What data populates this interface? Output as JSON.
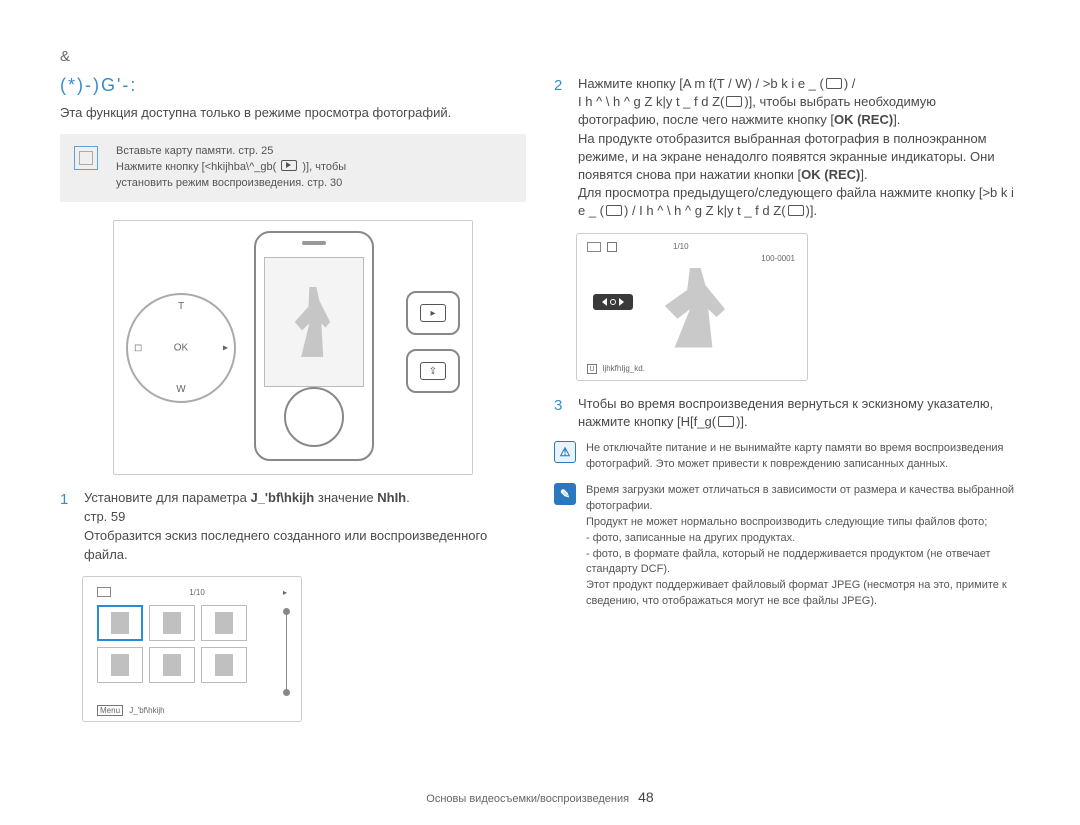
{
  "chapter": "&",
  "section_title": "(*)-)G'-:",
  "intro": "Эта функция доступна только в режиме просмотра фотографий.",
  "prep": {
    "line1": "Вставьте карту памяти.  стр. 25",
    "line2_a": "Нажмите кнопку [<hkijhba\\^_gb(",
    "line2_b": ")], чтобы",
    "line3": "установить режим воспроизведения.  стр. 30"
  },
  "dpad": {
    "t": "T",
    "w": "W",
    "ok": "OK",
    "left": "◻",
    "right": "▸"
  },
  "side_buttons": {
    "play": "▸",
    "share": "⇪"
  },
  "step1": {
    "num": "1",
    "l1a": "Установите для параметра ",
    "l1b": "J_'bf\\hkijh",
    "l1c": " значение ",
    "l1d": "NhIh",
    "l2": " стр. 59",
    "l3": "Отобразится эскиз последнего созданного или воспроизведенного файла."
  },
  "thumb": {
    "count": "1/10",
    "menu_label": "Menu",
    "menu_text": "J_'bf\\hkijh",
    "chevron": "▸"
  },
  "step2": {
    "num": "2",
    "l1": "Нажмите кнопку [A m f(T / W) / >b k i e _ (",
    "l1b": ") /",
    "l2": "I h ^ \\ h ^ g Z k|y t _ f d Z(",
    "l2b": ")], чтобы выбрать необходимую фотографию, после чего нажмите кнопку [",
    "l2c": "OK (REC)",
    "l2d": "].",
    "l3": "На продукте отобразится выбранная фотография в полноэкранном режиме, и на экране ненадолго появятся экранные индикаторы. Они появятся снова при нажатии кнопки [",
    "l3b": "OK (REC)",
    "l3c": "].",
    "l4": "Для просмотра предыдущего/следующего файла нажмите кнопку [>b k i e _ (",
    "l4b": ") / I h ^ \\ h ^ g Z k|y t _ f d Z(",
    "l4c": ")]."
  },
  "full": {
    "count": "1/10",
    "file": "100-0001",
    "cap_icon": "U",
    "caption": "IjhkfhIjg_kd."
  },
  "step3": {
    "num": "3",
    "text_a": "Чтобы во время воспроизведения вернуться к эскизному указателю, нажмите кнопку [H[f_g(",
    "text_b": ")]."
  },
  "warn": {
    "text": "Не отключайте питание и не вынимайте карту памяти во время воспроизведения фотографий. Это может привести к повреждению записанных данных."
  },
  "info": {
    "l1": "Время загрузки может отличаться в зависимости от размера и качества выбранной фотографии.",
    "l2": "Продукт не может нормально воспроизводить следующие типы файлов фото;",
    "l3": "- фото, записанные на других продуктах.",
    "l4": "- фото, в формате файла, который не поддерживается продуктом (не отвечает стандарту DCF).",
    "l5": "Этот продукт поддерживает файловый формат JPEG (несмотря на это, примите к сведению, что отображаться могут не все файлы JPEG)."
  },
  "footer": {
    "label": "Основы видеосъемки/воспроизведения",
    "page": "48"
  }
}
